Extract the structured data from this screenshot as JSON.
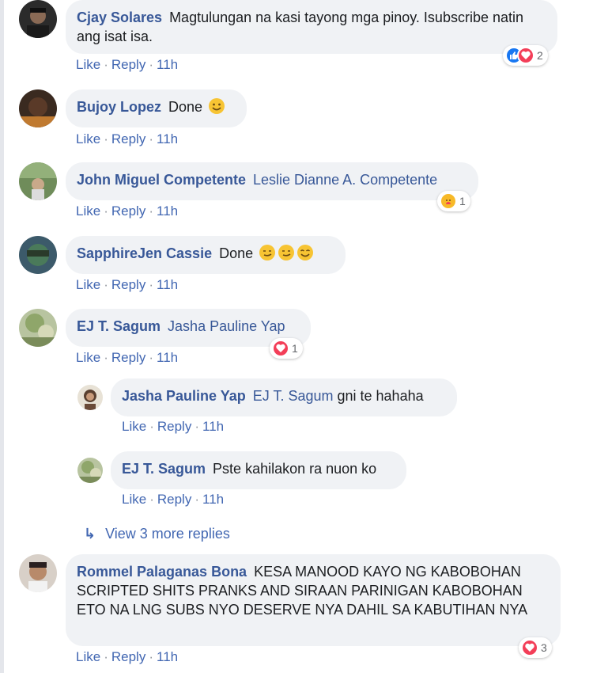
{
  "labels": {
    "like": "Like",
    "reply": "Reply",
    "sep": "·"
  },
  "comments": [
    {
      "author": "Cjay Solares",
      "text": "Magtulungan na kasi tayong mga pinoy. Isubscribe natin ang isat isa.",
      "time": "11h",
      "reaction_count": "2"
    },
    {
      "author": "Bujoy Lopez",
      "text": "Done",
      "time": "11h"
    },
    {
      "author": "John Miguel Competente",
      "mention": "Leslie Dianne A. Competente",
      "time": "11h",
      "reaction_count": "1"
    },
    {
      "author": "SapphireJen Cassie",
      "text": "Done",
      "time": "11h"
    },
    {
      "author": "EJ T. Sagum",
      "mention": "Jasha Pauline Yap",
      "time": "11h",
      "reaction_count": "1"
    },
    {
      "author": "Rommel Palaganas Bona",
      "text": "KESA MANOOD KAYO NG KABOBOHAN SCRIPTED SHITS PRANKS AND SIRAAN PARINIGAN KABOBOHAN ETO NA LNG SUBS NYO DESERVE NYA DAHIL SA KABUTIHAN NYA",
      "time": "11h",
      "reaction_count": "3"
    }
  ],
  "replies": [
    {
      "author": "Jasha Pauline Yap",
      "mention": "EJ T. Sagum",
      "text": "gni te hahaha",
      "time": "11h"
    },
    {
      "author": "EJ T. Sagum",
      "text": "Pste kahilakon ra nuon ko",
      "time": "11h"
    }
  ],
  "view_more": "View 3 more replies",
  "colors": {
    "bubble": "#f0f2f5",
    "link": "#4267b2",
    "author": "#385898",
    "like_blue": "#1877f2",
    "love_red": "#f33e58",
    "care_yellow": "#f7b928"
  },
  "icons": {
    "like": "like-icon",
    "love": "love-icon",
    "care": "care-icon",
    "smile": "smile-emoji",
    "reply_arrow": "reply-arrow-icon"
  }
}
